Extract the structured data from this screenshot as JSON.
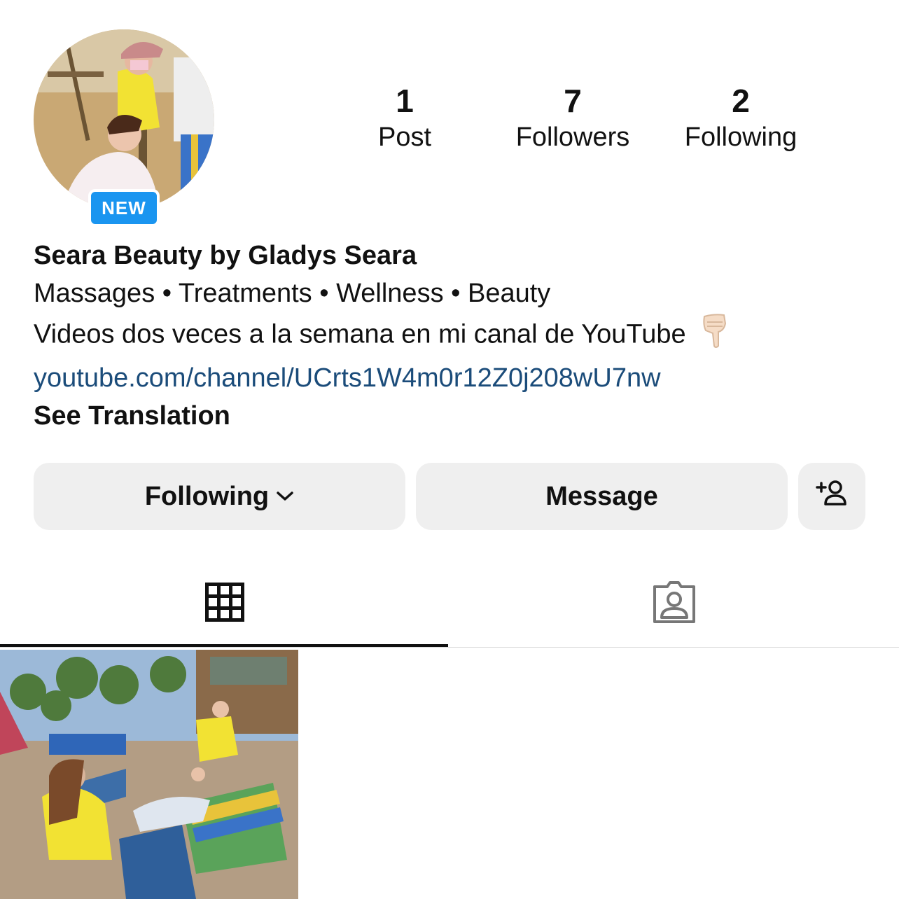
{
  "profile": {
    "badge": "NEW",
    "name": "Seara Beauty by Gladys Seara",
    "category_line": "Massages • Treatments • Wellness • Beauty",
    "bio_line": "Videos dos veces a la semana en mi canal de YouTube",
    "link": "youtube.com/channel/UCrts1W4m0r12Z0j208wU7nw",
    "translate_label": "See Translation"
  },
  "stats": [
    {
      "count": "1",
      "label": "Post"
    },
    {
      "count": "7",
      "label": "Followers"
    },
    {
      "count": "2",
      "label": "Following"
    }
  ],
  "buttons": {
    "following_label": "Following",
    "message_label": "Message"
  },
  "tabs": {
    "grid_icon": "grid-icon",
    "tagged_icon": "tagged-person-icon"
  },
  "colors": {
    "badge": "#1a95f0",
    "link": "#1b4c7a",
    "button_bg": "#efefef"
  }
}
